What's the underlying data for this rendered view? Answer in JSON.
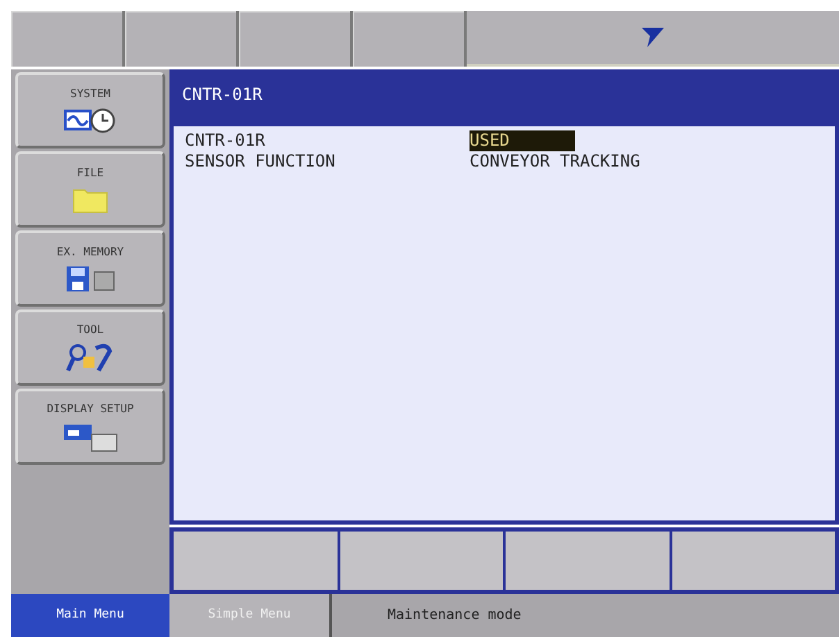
{
  "sidebar": {
    "items": [
      {
        "label": "SYSTEM",
        "kind": "system"
      },
      {
        "label": "FILE",
        "kind": "file"
      },
      {
        "label": "EX. MEMORY",
        "kind": "memory"
      },
      {
        "label": "TOOL",
        "kind": "tool"
      },
      {
        "label": "DISPLAY SETUP",
        "kind": "display"
      }
    ]
  },
  "panel": {
    "title": "CNTR-01R",
    "rows": [
      {
        "label": "CNTR-01R",
        "value": "USED",
        "selected": true
      },
      {
        "label": "SENSOR FUNCTION",
        "value": "CONVEYOR TRACKING",
        "selected": false
      }
    ]
  },
  "bottom": {
    "tabs": [
      {
        "label": "Main Menu",
        "selected": true
      },
      {
        "label": "Simple Menu",
        "selected": false
      }
    ],
    "status": "Maintenance mode"
  }
}
